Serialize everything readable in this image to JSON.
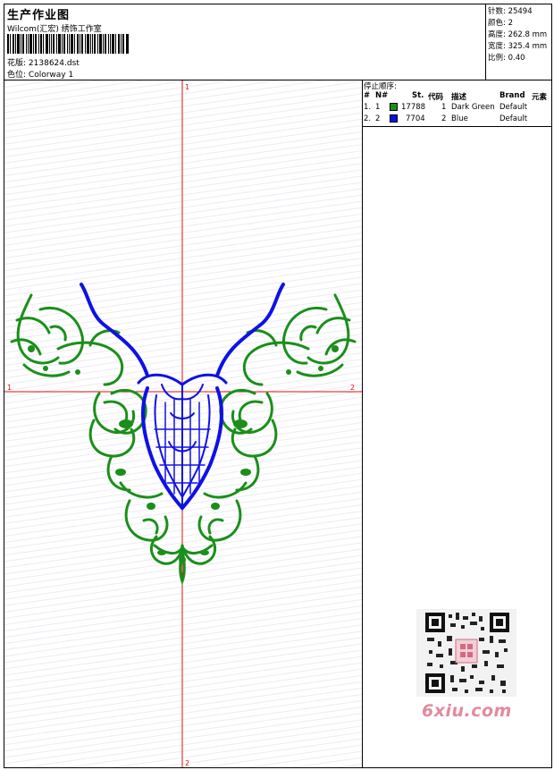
{
  "header": {
    "title": "生产作业图",
    "subtitle": "Wilcom(汇宏) 绣饰工作室",
    "design_label": "花版:",
    "design_file": "2138624.dst",
    "colorway_label": "色位:",
    "colorway": "Colorway 1"
  },
  "stats": [
    {
      "label": "针数:",
      "value": "25494"
    },
    {
      "label": "颜色:",
      "value": "2"
    },
    {
      "label": "高度:",
      "value": "262.8 mm"
    },
    {
      "label": "宽度:",
      "value": "325.4 mm"
    },
    {
      "label": "比例:",
      "value": "0.40"
    }
  ],
  "stop_sequence": {
    "title": "停止顺序:",
    "columns": {
      "num": "#",
      "needle": "N#",
      "stitches": "St.",
      "code": "代码",
      "desc": "描述",
      "brand": "Brand",
      "element": "元素"
    },
    "rows": [
      {
        "num": "1.",
        "needle": "1",
        "color": "#1a8f1a",
        "stitches": "17788",
        "code": "1",
        "desc": "Dark Green",
        "brand": "Default"
      },
      {
        "num": "2.",
        "needle": "2",
        "color": "#1010e6",
        "stitches": "7704",
        "code": "2",
        "desc": "Blue",
        "brand": "Default"
      }
    ]
  },
  "canvas": {
    "axis_labels": {
      "top": "1",
      "bottom": "2",
      "left": "1",
      "right": "2"
    },
    "axis_color": "#e01010",
    "green": "#1a8f1a",
    "blue": "#1010e6"
  },
  "watermark": "6xiu.com"
}
